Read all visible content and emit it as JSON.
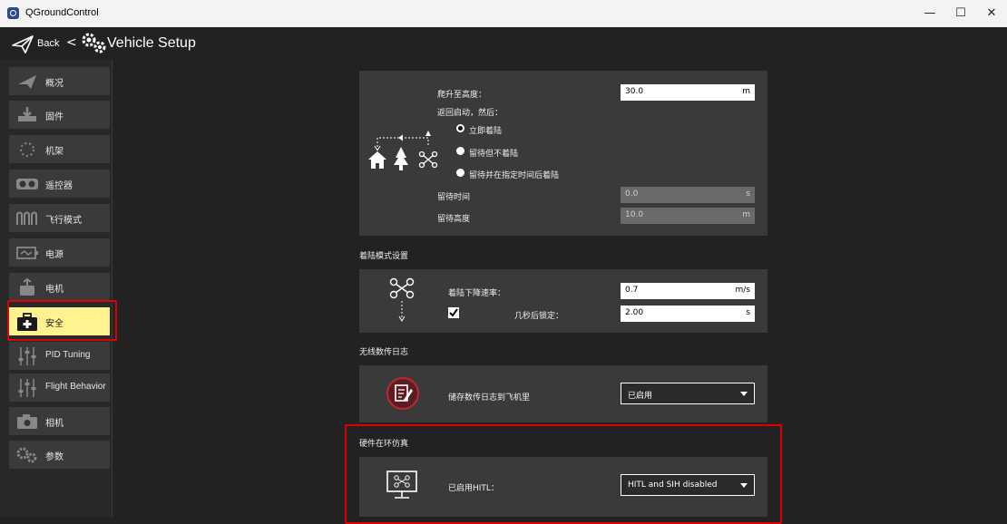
{
  "window": {
    "title": "QGroundControl",
    "minimize": "—",
    "maximize": "☐",
    "close": "✕"
  },
  "header": {
    "back_label": "Back",
    "separator": "<",
    "title": "Vehicle Setup"
  },
  "sidebar": {
    "items": [
      {
        "label": "概况",
        "icon": "plane-icon"
      },
      {
        "label": "固件",
        "icon": "download-icon"
      },
      {
        "label": "机架",
        "icon": "frame-icon"
      },
      {
        "label": "遥控器",
        "icon": "remote-control-icon"
      },
      {
        "label": "飞行模式",
        "icon": "wave-icon"
      },
      {
        "label": "电源",
        "icon": "battery-icon"
      },
      {
        "label": "电机",
        "icon": "motor-icon"
      },
      {
        "label": "安全",
        "icon": "first-aid-icon"
      },
      {
        "label": "PID Tuning",
        "icon": "sliders-icon"
      },
      {
        "label": "Flight Behavior",
        "icon": "sliders-icon"
      },
      {
        "label": "相机",
        "icon": "camera-icon"
      },
      {
        "label": "参数",
        "icon": "gears-icon"
      }
    ],
    "active_index": 7
  },
  "rtl": {
    "climb_label": "爬升至高度：",
    "climb_value": "30.0",
    "climb_unit": "m",
    "then_label": "返回启动，然后：",
    "options": [
      "立即着陆",
      "留待但不着陆",
      "留待并在指定时间后着陆"
    ],
    "selected_index": 0,
    "loiter_time_label": "留待时间",
    "loiter_time_value": "0.0",
    "loiter_time_unit": "s",
    "loiter_alt_label": "留待高度",
    "loiter_alt_value": "10.0",
    "loiter_alt_unit": "m"
  },
  "land": {
    "section_title": "着陆模式设置",
    "descent_label": "着陆下降速率：",
    "descent_value": "0.7",
    "descent_unit": "m/s",
    "disarm_checked": true,
    "disarm_label": "几秒后锁定：",
    "disarm_value": "2.00",
    "disarm_unit": "s"
  },
  "telemetry": {
    "section_title": "无线数传日志",
    "save_label": "储存数传日志到飞机里",
    "save_value": "已启用"
  },
  "hitl": {
    "section_title": "硬件在环仿真",
    "enable_label": "已启用HITL：",
    "enable_value": "HITL and SIH disabled"
  },
  "colors": {
    "background": "#222222",
    "panel": "#3a3a3a",
    "active_nav": "#fff291",
    "highlight": "#e00000"
  }
}
